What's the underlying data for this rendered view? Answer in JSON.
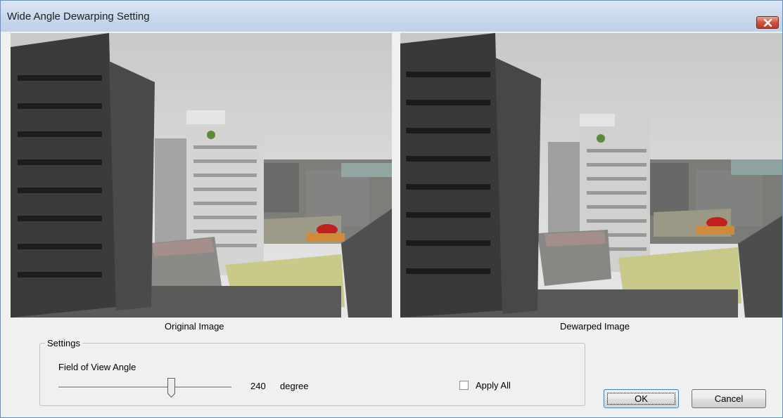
{
  "window": {
    "title": "Wide Angle Dewarping Setting",
    "close_icon": "close-icon"
  },
  "images": {
    "original_caption": "Original Image",
    "dewarped_caption": "Dewarped Image"
  },
  "settings": {
    "group_label": "Settings",
    "fov_label": "Field of View Angle",
    "fov_value": "240",
    "fov_unit": "degree",
    "fov_slider_fraction": 0.64,
    "apply_all_label": "Apply All",
    "apply_all_checked": false
  },
  "buttons": {
    "ok": "OK",
    "cancel": "Cancel"
  }
}
